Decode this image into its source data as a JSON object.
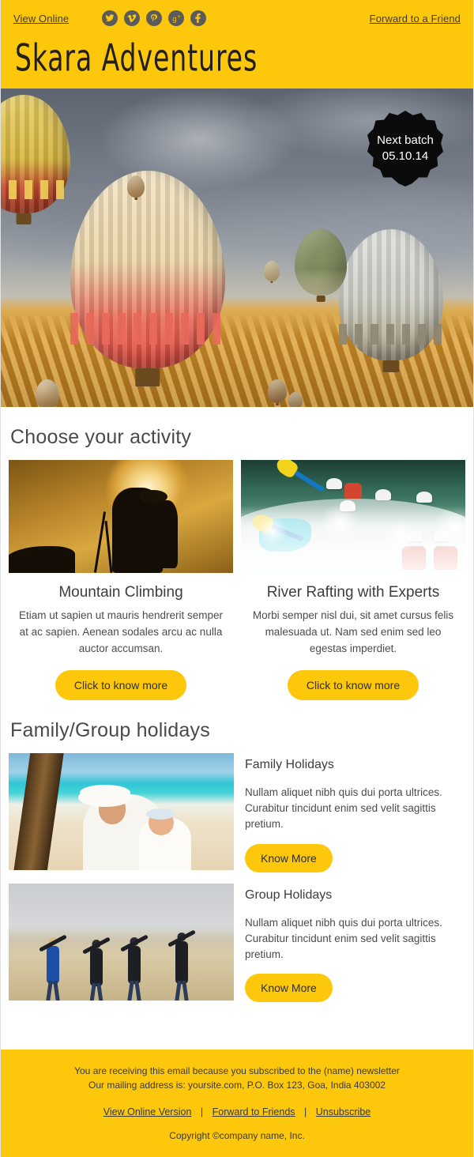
{
  "header": {
    "view_online": "View Online",
    "forward": "Forward to a Friend",
    "brand": "Skara Adventures",
    "social": [
      {
        "name": "twitter-icon",
        "label": "Twitter"
      },
      {
        "name": "vimeo-icon",
        "label": "Vimeo"
      },
      {
        "name": "pinterest-icon",
        "label": "Pinterest"
      },
      {
        "name": "googleplus-icon",
        "label": "Google Plus"
      },
      {
        "name": "facebook-icon",
        "label": "Facebook"
      }
    ]
  },
  "hero": {
    "alt": "Hot air balloons flying over rocky valley at sunrise",
    "badge_line1": "Next batch",
    "badge_line2": "05.10.14"
  },
  "activities": {
    "heading": "Choose your activity",
    "items": [
      {
        "image_alt": "Silhouette of hiker with backpack against sunset",
        "title": "Mountain Climbing",
        "body": "Etiam ut sapien ut mauris hendrerit semper at ac sapien. Aenean sodales arcu ac nulla auctor accumsan.",
        "cta": "Click to know more"
      },
      {
        "image_alt": "Whitewater rafting team paddling through rapids",
        "title": "River Rafting with Experts",
        "body": "Morbi semper nisl dui, sit amet cursus felis malesuada ut. Nam sed enim sed leo egestas imperdiet.",
        "cta": "Click to know more"
      }
    ]
  },
  "holidays": {
    "heading": "Family/Group holidays",
    "items": [
      {
        "image_alt": "Mother and baby on tropical beach under palm tree",
        "title": "Family Holidays",
        "body": "Nullam aliquet nibh quis dui porta ultrices. Curabitur tincidunt enim sed velit sagittis pretium.",
        "cta": "Know More"
      },
      {
        "image_alt": "Four friends jumping on a sand dune",
        "title": "Group Holidays",
        "body": "Nullam aliquet nibh quis dui porta ultrices. Curabitur tincidunt enim sed velit sagittis pretium.",
        "cta": "Know More"
      }
    ]
  },
  "footer": {
    "line1": "You are receiving this email because you subscribed to the (name) newsletter",
    "line2": "Our mailing address is: yoursite.com, P.O. Box 123, Goa, India 403002",
    "link1": "View Online Version",
    "link2": "Forward to Friends",
    "link3": "Unsubscribe",
    "separator": "|",
    "copyright": "Copyright ©company name, Inc."
  },
  "colors": {
    "brand_yellow": "#fdc70c",
    "badge_black": "#0b0b0b",
    "text_dark": "#3d3d3d"
  }
}
